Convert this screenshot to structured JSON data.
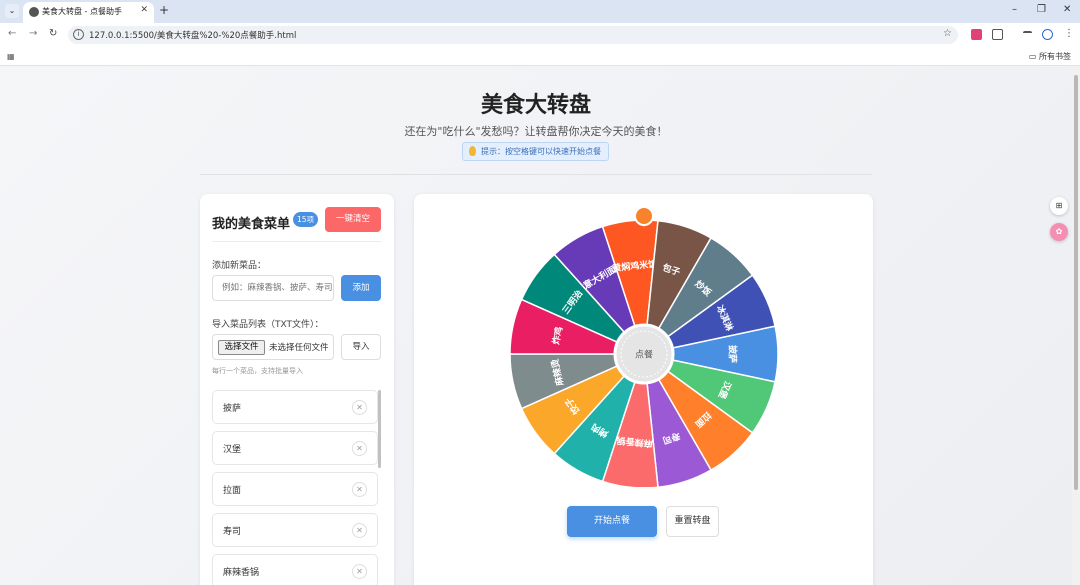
{
  "browser": {
    "tab_title": "美食大转盘 - 点餐助手",
    "url": "127.0.0.1:5500/美食大转盘%20-%20点餐助手.html",
    "bookmarks_folder": "所有书签"
  },
  "page": {
    "title": "美食大转盘",
    "subtitle": "还在为\"吃什么\"发愁吗？让转盘帮你决定今天的美食！",
    "hint": "提示：按空格键可以快速开始点餐"
  },
  "menu": {
    "title": "我的美食菜单",
    "count_badge": "15项",
    "clear_label": "一键清空",
    "add_label": "添加新菜品：",
    "add_placeholder": "例如：麻辣香锅、披萨、寿司",
    "add_button": "添加",
    "import_label": "导入菜品列表（TXT文件）：",
    "file_button": "选择文件",
    "file_status": "未选择任何文件",
    "import_button": "导入",
    "import_help": "每行一个菜品，支持批量导入",
    "items": [
      "披萨",
      "汉堡",
      "拉面",
      "寿司",
      "麻辣香锅"
    ]
  },
  "wheel": {
    "center_label": "点餐",
    "segments": [
      {
        "label": "披萨",
        "color": "#4a90e2"
      },
      {
        "label": "汉堡",
        "color": "#50c878"
      },
      {
        "label": "拉面",
        "color": "#ff7f2a"
      },
      {
        "label": "寿司",
        "color": "#9b59d6"
      },
      {
        "label": "麻辣香锅",
        "color": "#fc6b6b"
      },
      {
        "label": "烤肉",
        "color": "#20b2aa"
      },
      {
        "label": "饺子",
        "color": "#fba72a"
      },
      {
        "label": "麻辣烫",
        "color": "#7f8c8d"
      },
      {
        "label": "炸鸡",
        "color": "#e91e63"
      },
      {
        "label": "三明治",
        "color": "#00897b"
      },
      {
        "label": "意大利面",
        "color": "#673ab7"
      },
      {
        "label": "黄焖鸡米饭",
        "color": "#ff5722"
      },
      {
        "label": "包子",
        "color": "#795548"
      },
      {
        "label": "炒饭",
        "color": "#607d8b"
      },
      {
        "label": "冰淇淋",
        "color": "#3f51b5"
      }
    ],
    "start_button": "开始点餐",
    "reset_button": "重置转盘"
  }
}
